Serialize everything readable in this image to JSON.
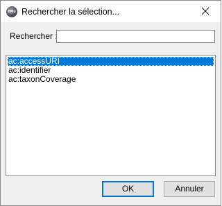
{
  "window": {
    "title": "Rechercher la sélection...",
    "app_icon_text": "EMu",
    "close_icon": "close-icon"
  },
  "search": {
    "label": "Rechercher :",
    "value": "",
    "placeholder": ""
  },
  "list": {
    "items": [
      {
        "label": "ac:accessURI",
        "selected": true
      },
      {
        "label": "ac:identifier",
        "selected": false
      },
      {
        "label": "ac:taxonCoverage",
        "selected": false
      }
    ]
  },
  "buttons": {
    "ok_label": "OK",
    "cancel_label": "Annuler"
  },
  "colors": {
    "selection": "#0078d7",
    "dialog_bg": "#f0f0f0",
    "default_button_border": "#0078d7"
  }
}
